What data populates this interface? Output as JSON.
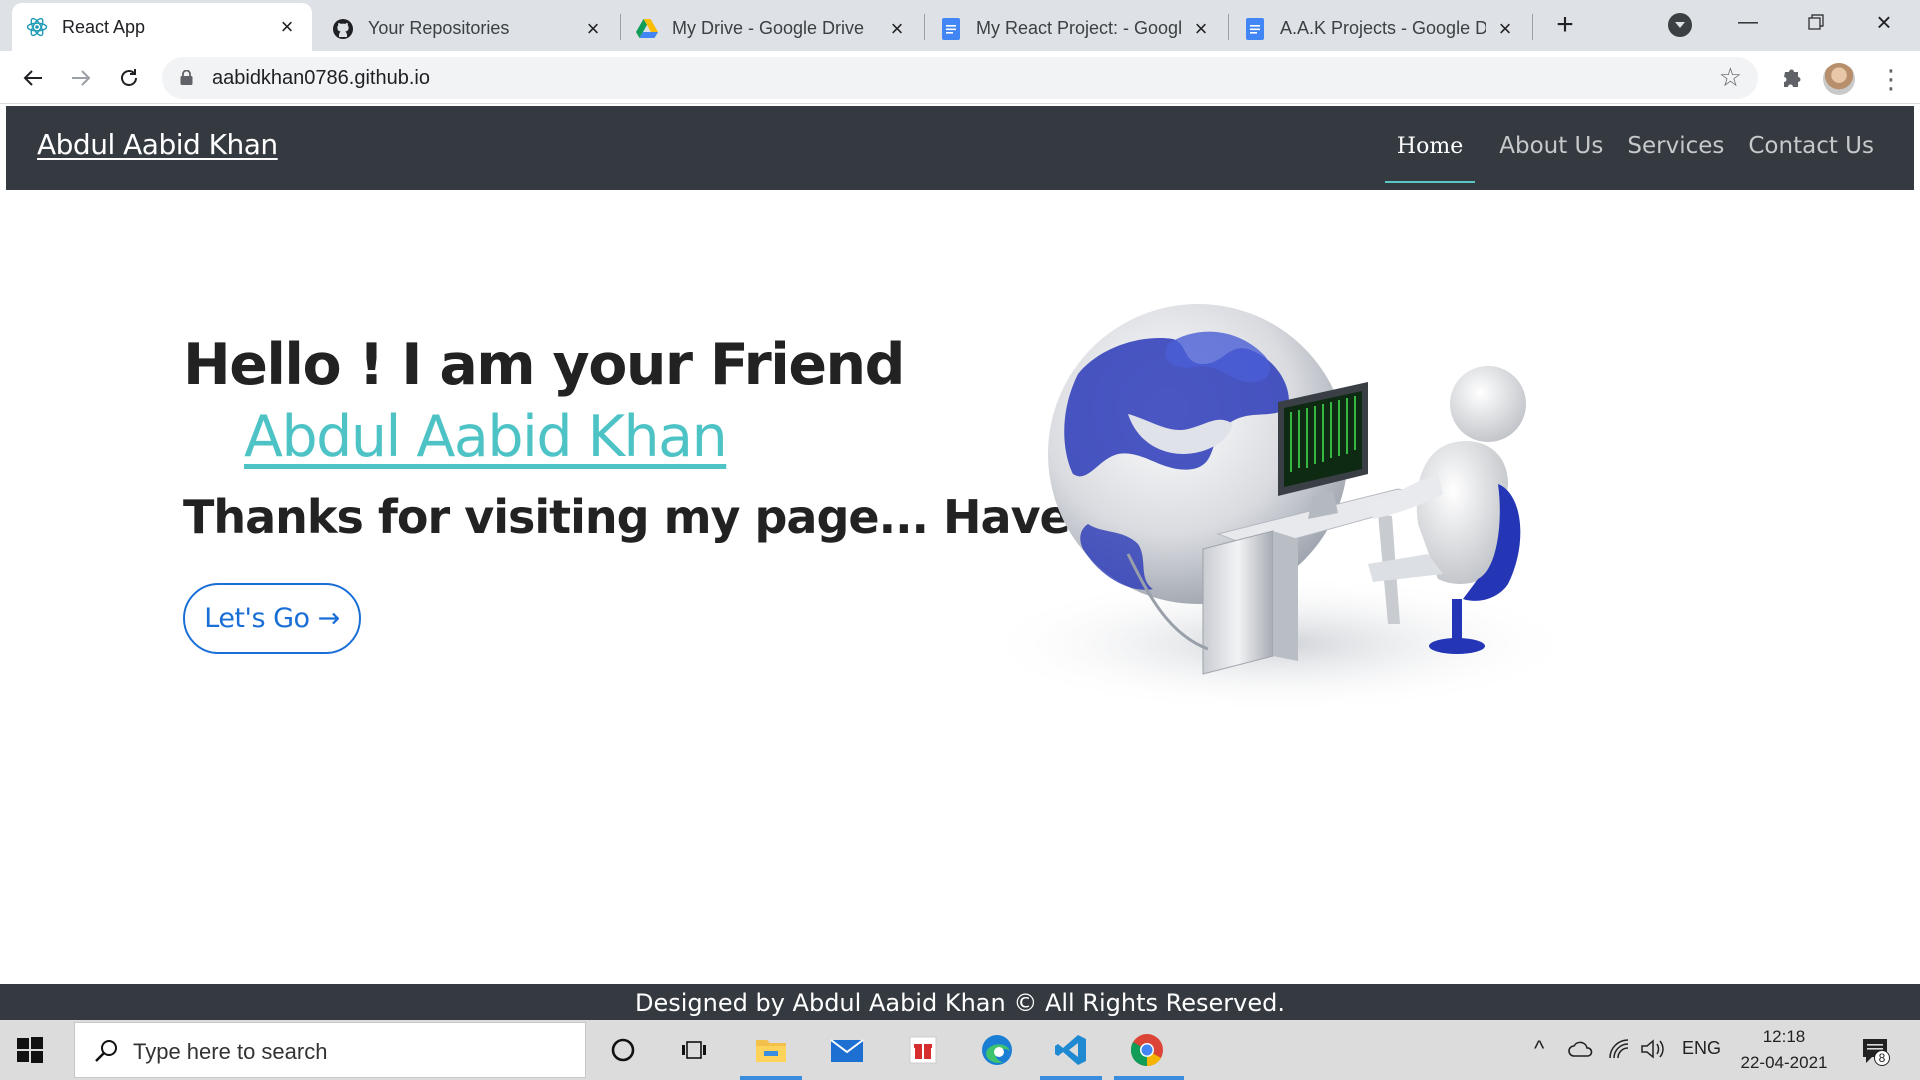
{
  "browser": {
    "tabs": [
      {
        "label": "React App",
        "icon": "react-icon",
        "active": true
      },
      {
        "label": "Your Repositories",
        "icon": "github-icon",
        "active": false
      },
      {
        "label": "My Drive - Google Drive",
        "icon": "google-drive-icon",
        "active": false
      },
      {
        "label": "My React Project: - Googl",
        "icon": "google-docs-icon",
        "active": false
      },
      {
        "label": "A.A.K Projects - Google Dc",
        "icon": "google-docs-icon",
        "active": false
      }
    ],
    "url": "aabidkhan0786.github.io"
  },
  "site": {
    "brand": "Abdul Aabid Khan",
    "nav": [
      {
        "label": "Home",
        "active": true
      },
      {
        "label": "About Us",
        "active": false
      },
      {
        "label": "Services",
        "active": false
      },
      {
        "label": "Contact Us",
        "active": false
      }
    ],
    "hero": {
      "greeting": "Hello ! I am your Friend",
      "name": "Abdul Aabid Khan",
      "tagline": "Thanks for visiting my page... Have fun",
      "cta": "Let's Go →"
    },
    "footer": "Designed by Abdul Aabid Khan © All Rights Reserved."
  },
  "taskbar": {
    "search_placeholder": "Type here to search",
    "language": "ENG",
    "time": "12:18",
    "date": "22-04-2021",
    "notification_count": "8"
  },
  "colors": {
    "navbar": "#343a40",
    "accent": "#4dc3c6",
    "cta": "#1a6fd6"
  }
}
